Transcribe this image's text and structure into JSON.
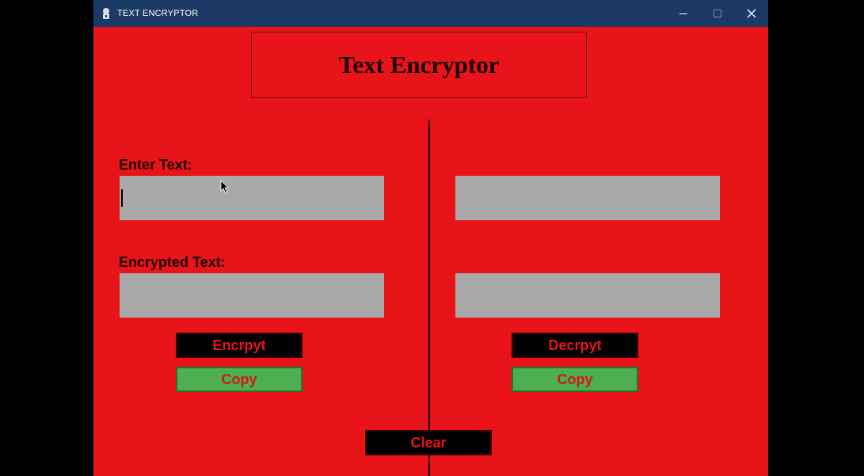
{
  "window": {
    "title": "TEXT ENCRYPTOR",
    "minimize_icon": "minimize-icon",
    "maximize_icon": "maximize-icon",
    "close_icon": "close-icon"
  },
  "header": {
    "title": "Text Encryptor"
  },
  "left_panel": {
    "enter_label": "Enter Text:",
    "enter_value": "",
    "encrypted_label": "Encrypted Text:",
    "encrypted_value": "",
    "encrypt_button": "Encrpyt",
    "copy_button": "Copy"
  },
  "right_panel": {
    "input_value": "",
    "output_value": "",
    "decrypt_button": "Decrpyt",
    "copy_button": "Copy"
  },
  "footer": {
    "clear_button": "Clear"
  },
  "colors": {
    "background": "#e8141a",
    "titlebar": "#1b3a66",
    "textbox": "#a9a9a9",
    "button_dark": "#000000",
    "button_green": "#4caf50"
  }
}
